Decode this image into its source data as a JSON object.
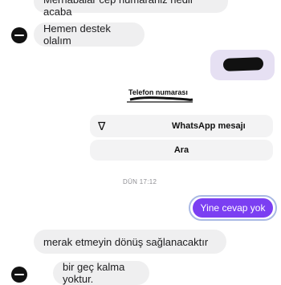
{
  "messages": {
    "top_incoming": "Merhabalar cep numaraniz nedir acaba",
    "support_reply": "Hemen destek olalım",
    "phone_card_label": "Telefon numarası",
    "whatsapp_label": "WhatsApp mesajı",
    "call_label": "Ara",
    "timestamp": "DÜN 17:12",
    "outgoing_reply": "Yine cevap yok",
    "reassure_text": "merak etmeyin dönüş sağlanacaktır",
    "late_text": "bir geç kalma yoktur."
  },
  "colors": {
    "outgoing_bubble": "#7b3ff2",
    "incoming_bubble": "#efeff0",
    "text": "#1c1c1e",
    "muted": "#8e8e93"
  },
  "icons": {
    "avatar": "brand-avatar",
    "whatsapp": "v-checkmark-icon"
  }
}
